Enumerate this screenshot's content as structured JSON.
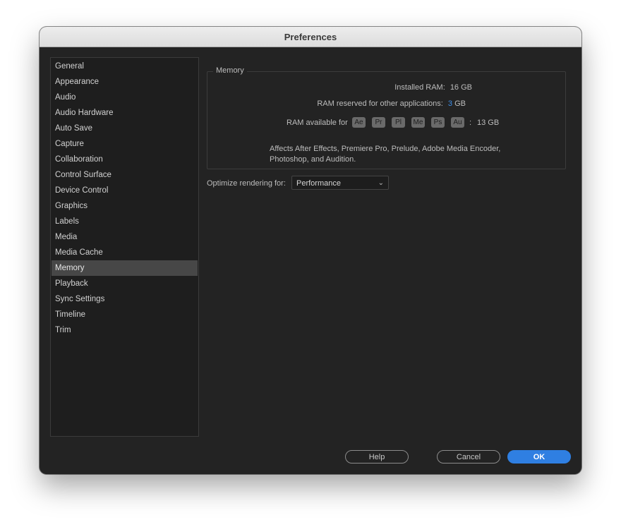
{
  "window": {
    "title": "Preferences"
  },
  "sidebar": {
    "items": [
      {
        "label": "General"
      },
      {
        "label": "Appearance"
      },
      {
        "label": "Audio"
      },
      {
        "label": "Audio Hardware"
      },
      {
        "label": "Auto Save"
      },
      {
        "label": "Capture"
      },
      {
        "label": "Collaboration"
      },
      {
        "label": "Control Surface"
      },
      {
        "label": "Device Control"
      },
      {
        "label": "Graphics"
      },
      {
        "label": "Labels"
      },
      {
        "label": "Media"
      },
      {
        "label": "Media Cache"
      },
      {
        "label": "Memory"
      },
      {
        "label": "Playback"
      },
      {
        "label": "Sync Settings"
      },
      {
        "label": "Timeline"
      },
      {
        "label": "Trim"
      }
    ],
    "selected": "Memory"
  },
  "memory": {
    "group_label": "Memory",
    "installed_label": "Installed RAM:",
    "installed_value": "16 GB",
    "reserved_label": "RAM reserved for other applications:",
    "reserved_value": "3",
    "reserved_unit": "GB",
    "available_label": "RAM available for",
    "apps": [
      {
        "abbr": "Ae"
      },
      {
        "abbr": "Pr"
      },
      {
        "abbr": "Pl"
      },
      {
        "abbr": "Me"
      },
      {
        "abbr": "Ps"
      },
      {
        "abbr": "Au"
      }
    ],
    "available_sep": ":",
    "available_value": "13 GB",
    "note": "Affects After Effects, Premiere Pro, Prelude, Adobe Media Encoder, Photoshop, and Audition."
  },
  "rendering": {
    "label": "Optimize rendering for:",
    "selected": "Performance"
  },
  "buttons": {
    "help": "Help",
    "cancel": "Cancel",
    "ok": "OK"
  },
  "colors": {
    "accent": "#2f7fe2",
    "reserved_value": "#3d8ee8"
  }
}
